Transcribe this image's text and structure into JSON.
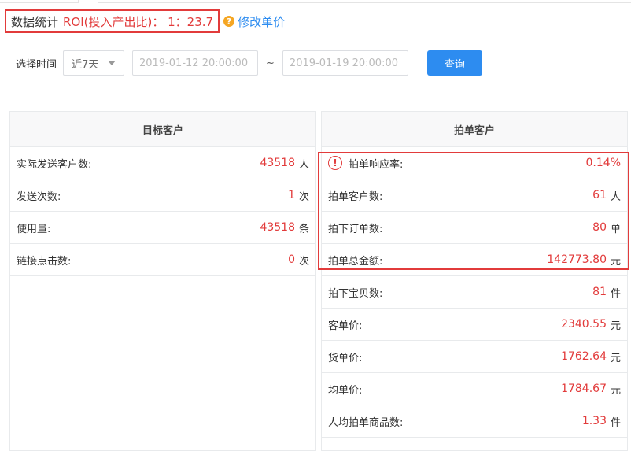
{
  "header": {
    "section_label": "数据统计",
    "roi_text": "ROI(投入产出比)：  1：23.7",
    "help_icon": "?",
    "edit_link": "修改单价"
  },
  "filter": {
    "time_label": "选择时间",
    "range_select": "近7天",
    "start_date": "2019-01-12 20:00:00",
    "tilde": "~",
    "end_date": "2019-01-19 20:00:00",
    "query_button": "查询"
  },
  "left_panel": {
    "title": "目标客户",
    "rows": [
      {
        "label": "实际发送客户数:",
        "value": "43518",
        "unit": "人"
      },
      {
        "label": "发送次数:",
        "value": "1",
        "unit": "次"
      },
      {
        "label": "使用量:",
        "value": "43518",
        "unit": "条"
      },
      {
        "label": "链接点击数:",
        "value": "0",
        "unit": "次"
      }
    ]
  },
  "right_panel": {
    "title": "拍单客户",
    "alert_icon": "!",
    "rows": [
      {
        "label": "拍单响应率:",
        "value": "0.14%",
        "unit": ""
      },
      {
        "label": "拍单客户数:",
        "value": "61",
        "unit": "人"
      },
      {
        "label": "拍下订单数:",
        "value": "80",
        "unit": "单"
      },
      {
        "label": "拍单总金额:",
        "value": "142773.80",
        "unit": "元"
      },
      {
        "label": "拍下宝贝数:",
        "value": "81",
        "unit": "件"
      },
      {
        "label": "客单价:",
        "value": "2340.55",
        "unit": "元"
      },
      {
        "label": "货单价:",
        "value": "1762.64",
        "unit": "元"
      },
      {
        "label": "均单价:",
        "value": "1784.67",
        "unit": "元"
      },
      {
        "label": "人均拍单商品数:",
        "value": "1.33",
        "unit": "件"
      }
    ]
  },
  "colors": {
    "accent_red": "#e23b3b",
    "primary_blue": "#2d8cf0",
    "help_orange": "#f5a623"
  }
}
